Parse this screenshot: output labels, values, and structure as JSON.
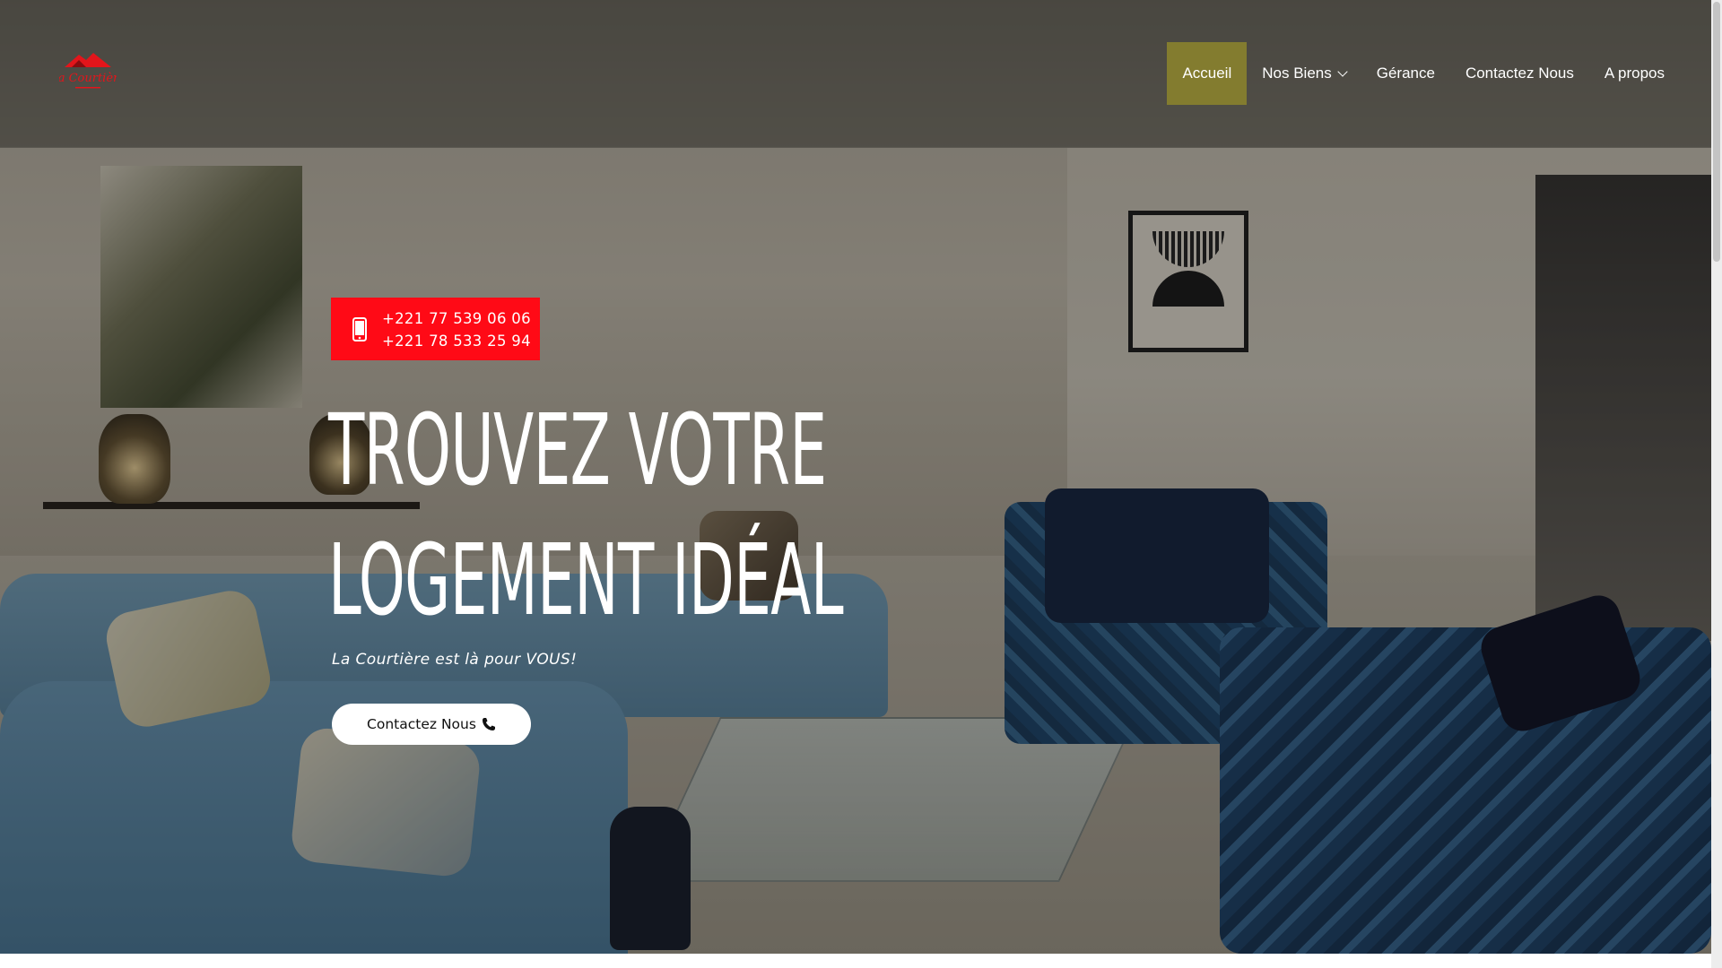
{
  "header": {
    "logo_text": "La Courtière",
    "nav": [
      {
        "label": "Accueil",
        "active": true
      },
      {
        "label": "Nos Biens",
        "has_dropdown": true
      },
      {
        "label": "Gérance"
      },
      {
        "label": "Contactez Nous"
      },
      {
        "label": "A propos"
      }
    ]
  },
  "hero": {
    "phones": [
      "+221 77 539 06 06",
      "+221 78 533 25 94"
    ],
    "headline_line1": "TROUVEZ VOTRE",
    "headline_line2": "LOGEMENT IDÉAL",
    "tagline": "La Courtière est là pour VOUS!",
    "cta_label": "Contactez Nous",
    "cta_icon": "phone-icon"
  },
  "colors": {
    "nav_active_bg": "#837c2f",
    "phone_box_bg": "#ff0a16",
    "logo_red": "#e3151b"
  }
}
